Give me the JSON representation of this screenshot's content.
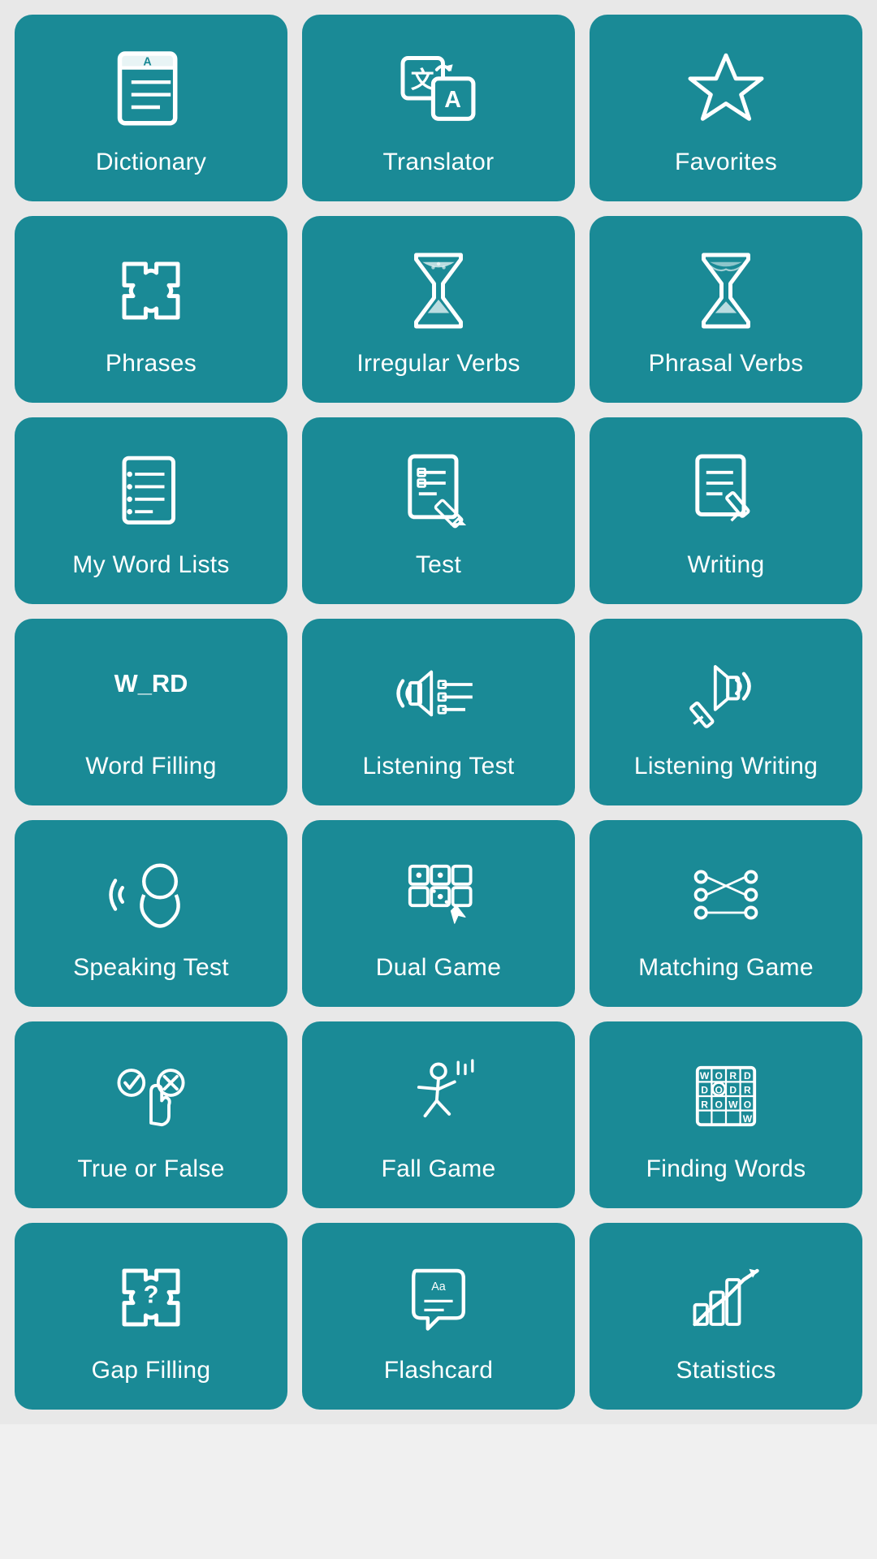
{
  "tiles": [
    {
      "id": "dictionary",
      "label": "Dictionary"
    },
    {
      "id": "translator",
      "label": "Translator"
    },
    {
      "id": "favorites",
      "label": "Favorites"
    },
    {
      "id": "phrases",
      "label": "Phrases"
    },
    {
      "id": "irregular-verbs",
      "label": "Irregular Verbs"
    },
    {
      "id": "phrasal-verbs",
      "label": "Phrasal Verbs"
    },
    {
      "id": "my-word-lists",
      "label": "My Word Lists"
    },
    {
      "id": "test",
      "label": "Test"
    },
    {
      "id": "writing",
      "label": "Writing"
    },
    {
      "id": "word-filling",
      "label": "Word Filling"
    },
    {
      "id": "listening-test",
      "label": "Listening Test"
    },
    {
      "id": "listening-writing",
      "label": "Listening Writing"
    },
    {
      "id": "speaking-test",
      "label": "Speaking Test"
    },
    {
      "id": "dual-game",
      "label": "Dual Game"
    },
    {
      "id": "matching-game",
      "label": "Matching Game"
    },
    {
      "id": "true-or-false",
      "label": "True or False"
    },
    {
      "id": "fall-game",
      "label": "Fall Game"
    },
    {
      "id": "finding-words",
      "label": "Finding Words"
    },
    {
      "id": "gap-filling",
      "label": "Gap Filling"
    },
    {
      "id": "flashcard",
      "label": "Flashcard"
    },
    {
      "id": "statistics",
      "label": "Statistics"
    }
  ]
}
